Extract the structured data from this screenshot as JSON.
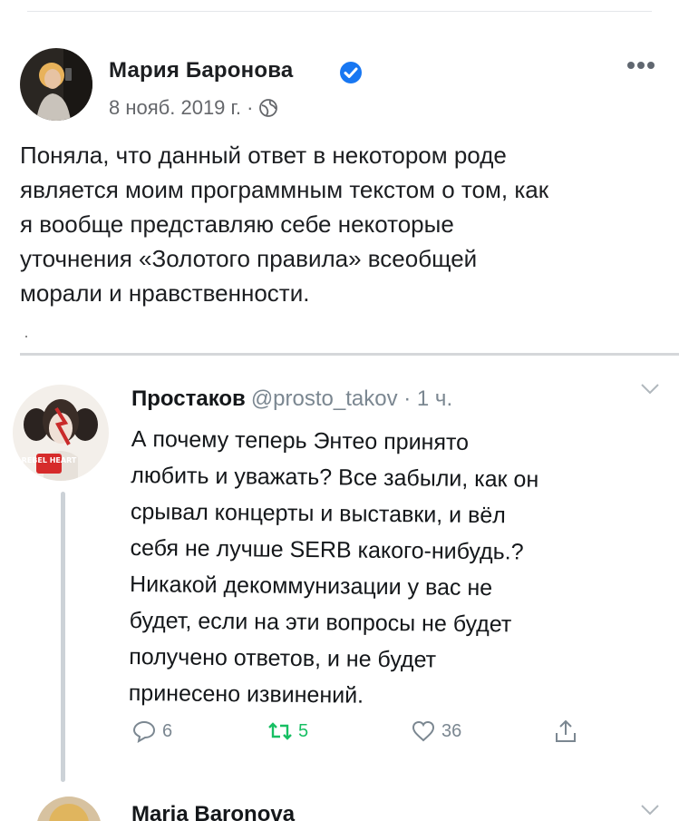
{
  "post": {
    "author": "Мария Баронова",
    "date": "8 нояб. 2019 г. ·",
    "text_lines": [
      "Поняла, что данный ответ в некотором роде",
      "является моим программным текстом о том, как",
      "я вообще представляю себе некоторые",
      "уточнения «Золотого правила» всеобщей",
      "морали и нравственности."
    ],
    "icons": [
      "verified-badge-icon",
      "globe-icon",
      "more-options-icon"
    ],
    "accent_color": "#1877f2"
  },
  "tweet": {
    "author": "Простаков",
    "handle": "@prosto_takov · 1 ч.",
    "text_lines": [
      "А почему теперь Энтео принято",
      "любить и уважать? Все забыли, как он",
      "срывал концерты и выставки, и вёл",
      "себя не лучше SERB какого-нибудь.?",
      "Никакой декоммунизации у вас не",
      "будет, если на эти вопросы не будет",
      "получено ответов, и не будет",
      "принесено извинений."
    ],
    "avatar_badge": "REBEL HEART",
    "replies": "6",
    "retweets": "5",
    "likes": "36",
    "retweet_color": "#17bf63",
    "icons": [
      "reply-icon",
      "retweet-icon",
      "like-icon",
      "share-icon",
      "chevron-down-icon"
    ]
  },
  "next_reply": {
    "author": "Maria Baronova"
  }
}
